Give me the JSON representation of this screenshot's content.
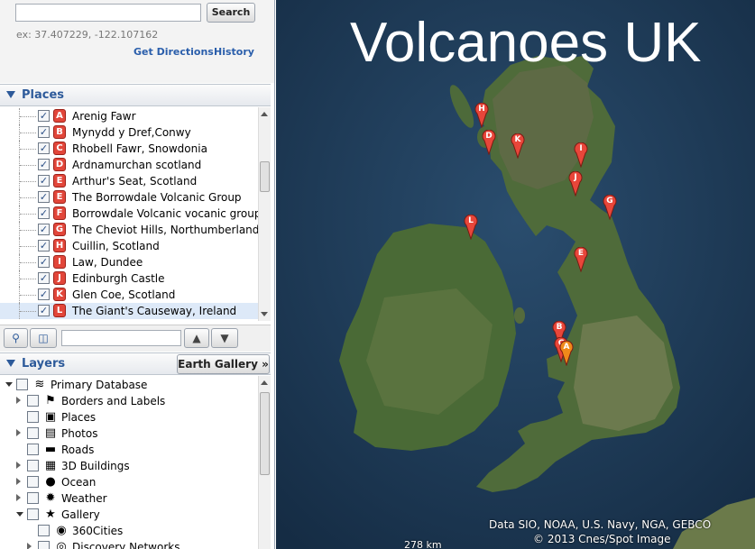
{
  "search": {
    "input_value": "",
    "button_label": "Search",
    "hint": "ex: 37.407229, -122.107162",
    "get_directions": "Get Directions",
    "history": "History"
  },
  "places": {
    "title": "Places",
    "items": [
      {
        "letter": "A",
        "label": "Arenig Fawr",
        "checked": true
      },
      {
        "letter": "B",
        "label": "Mynydd y Dref,Conwy",
        "checked": true
      },
      {
        "letter": "C",
        "label": "Rhobell Fawr, Snowdonia",
        "checked": true
      },
      {
        "letter": "D",
        "label": "Ardnamurchan scotland",
        "checked": true
      },
      {
        "letter": "E",
        "label": "Arthur's Seat, Scotland",
        "checked": true
      },
      {
        "letter": "E",
        "label": "The Borrowdale Volcanic Group",
        "checked": true
      },
      {
        "letter": "F",
        "label": "Borrowdale Volcanic vocanic group",
        "checked": true
      },
      {
        "letter": "G",
        "label": "The Cheviot Hills, Northumberland",
        "checked": true
      },
      {
        "letter": "H",
        "label": "Cuillin, Scotland",
        "checked": true
      },
      {
        "letter": "I",
        "label": "Law, Dundee",
        "checked": true
      },
      {
        "letter": "J",
        "label": "Edinburgh Castle",
        "checked": true
      },
      {
        "letter": "K",
        "label": "Glen Coe, Scotland",
        "checked": true
      },
      {
        "letter": "L",
        "label": "The Giant's Causeway, Ireland",
        "checked": true,
        "selected": true
      }
    ]
  },
  "layers": {
    "title": "Layers",
    "gallery_button": "Earth Gallery »",
    "items": [
      {
        "label": "Primary Database",
        "icon": "database-icon",
        "glyph": "≋",
        "depth": 0,
        "expander": "open"
      },
      {
        "label": "Borders and Labels",
        "icon": "flag-icon",
        "glyph": "⚑",
        "depth": 1,
        "expander": "closed"
      },
      {
        "label": "Places",
        "icon": "places-icon",
        "glyph": "▣",
        "depth": 1,
        "expander": "none"
      },
      {
        "label": "Photos",
        "icon": "photo-icon",
        "glyph": "▤",
        "depth": 1,
        "expander": "closed"
      },
      {
        "label": "Roads",
        "icon": "road-icon",
        "glyph": "▬",
        "depth": 1,
        "expander": "none"
      },
      {
        "label": "3D Buildings",
        "icon": "building-icon",
        "glyph": "▦",
        "depth": 1,
        "expander": "closed"
      },
      {
        "label": "Ocean",
        "icon": "ocean-icon",
        "glyph": "●",
        "depth": 1,
        "expander": "closed"
      },
      {
        "label": "Weather",
        "icon": "weather-icon",
        "glyph": "✹",
        "depth": 1,
        "expander": "closed"
      },
      {
        "label": "Gallery",
        "icon": "gallery-icon",
        "glyph": "★",
        "depth": 1,
        "expander": "open"
      },
      {
        "label": "360Cities",
        "icon": "cities360-icon",
        "glyph": "◉",
        "depth": 2,
        "expander": "none"
      },
      {
        "label": "Discovery Networks",
        "icon": "discovery-icon",
        "glyph": "◎",
        "depth": 2,
        "expander": "closed"
      }
    ]
  },
  "map": {
    "title": "Volcanoes UK",
    "attribution": "Data SIO, NOAA, U.S. Navy, NGA, GEBCO",
    "copyright": "© 2013 Cnes/Spot Image",
    "scale": "278 km",
    "pins": [
      {
        "letter": "H",
        "color": "#e8463a"
      },
      {
        "letter": "D",
        "color": "#e8463a"
      },
      {
        "letter": "K",
        "color": "#e8463a"
      },
      {
        "letter": "I",
        "color": "#e8463a"
      },
      {
        "letter": "J",
        "color": "#e8463a"
      },
      {
        "letter": "G",
        "color": "#e8463a"
      },
      {
        "letter": "L",
        "color": "#e8463a"
      },
      {
        "letter": "E",
        "color": "#e8463a"
      },
      {
        "letter": "B",
        "color": "#e8463a"
      },
      {
        "letter": "C",
        "color": "#e8463a"
      },
      {
        "letter": "A",
        "color": "#f08a1a"
      }
    ]
  }
}
